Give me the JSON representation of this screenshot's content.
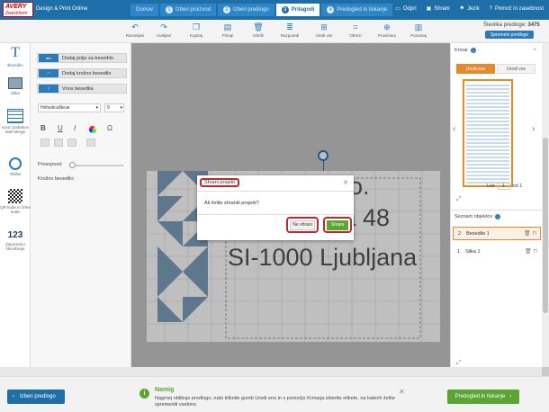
{
  "header": {
    "logo_line1": "AVERY",
    "logo_line2": "Zweckform",
    "app_title": "Design & Print Online",
    "steps": [
      {
        "label": "Domov",
        "num": ""
      },
      {
        "label": "Izberi proizvod",
        "num": "1"
      },
      {
        "label": "Izberi predlogo",
        "num": "2"
      },
      {
        "label": "Prilagodi",
        "num": "3"
      },
      {
        "label": "Predogled in tiskanje",
        "num": "4"
      }
    ],
    "links": {
      "open": "Odpri",
      "save": "Shrani",
      "language": "Jezik",
      "help": "Pomoč in zasebnost"
    }
  },
  "toolbar": {
    "buttons": [
      "Razveljavi",
      "Uveljavi",
      "Kopiraj",
      "Prilepi",
      "Izbriši",
      "Razporedi",
      "Uredi vse",
      "Obrezi",
      "Povečava",
      "Poravnaj"
    ],
    "size_label": "Številka predloge:",
    "size_value": "3475",
    "save_design": "Spremeni predlogo"
  },
  "leftrail": {
    "text": "Besedilo",
    "image": "Slika",
    "spreadsheet": "Uvoz podatkov Mail Merge",
    "shapes": "Oblike",
    "qr": "QR kode in črtne kode",
    "numbering": "Zaporedno številčenje"
  },
  "panel": {
    "add_field": "Dodaj polje za besedilo",
    "add_curved": "Dodaj krožno besedilo",
    "insert_text": "Vnos besedila",
    "font": "HelveticaNeue",
    "size": "9",
    "transparency": "Prosojnost:",
    "curved_text": "Krožno besedilo:"
  },
  "canvas": {
    "line1": "o.",
    "line2": "ta 48",
    "line3": "SI-1000 Ljubljana"
  },
  "dialog": {
    "title": "Shrani projekt",
    "body": "Ali želite shraniti projekt?",
    "no": "Ne shrani",
    "yes": "Shrani"
  },
  "rpanel": {
    "title": "Krmar",
    "tab_one": "Uredi eno",
    "tab_all": "Uredi vse",
    "list_label": "List",
    "page_num": "1",
    "of_label": "od 1",
    "objects_title": "Seznam objektov",
    "objects": [
      {
        "num": "2",
        "label": "Besedilo 1"
      },
      {
        "num": "1",
        "label": "Slika 1"
      }
    ]
  },
  "footer": {
    "back": "Izberi predlogo",
    "tip_title": "Namig",
    "tip_text": "Nagrnej oblikuje predlogo, nato kliknite gumb Uredi eno in s pomočjo Krmarja izberite etikete, na katerih želite spremeniti vsebino.",
    "next": "Predogled in tiskanje"
  },
  "colors": {
    "brand": "#1e6fa8",
    "accent": "#e38b2c",
    "go": "#5aa630",
    "highlight": "#c0282d"
  }
}
